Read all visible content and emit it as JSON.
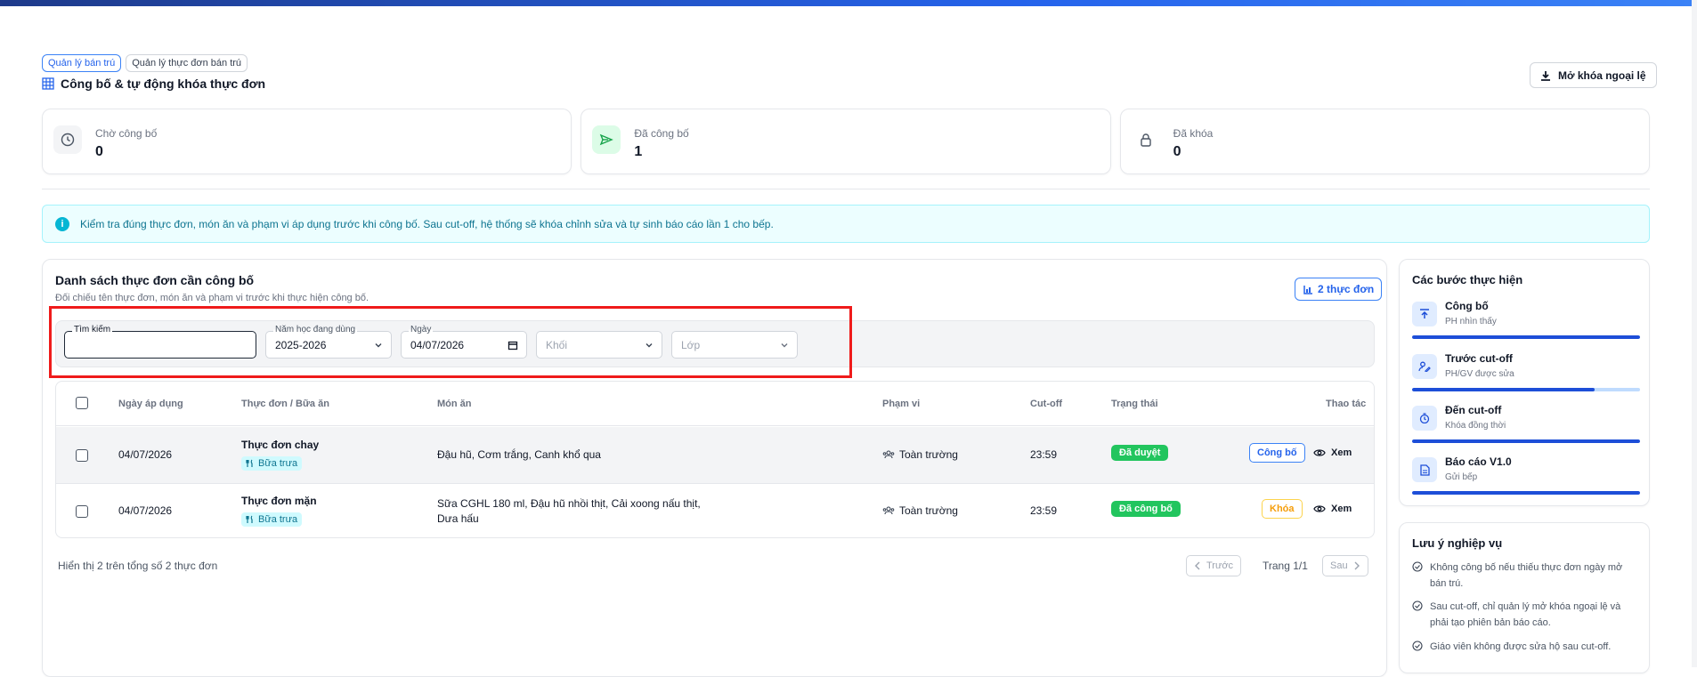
{
  "breadcrumbs": [
    "Quản lý bán trú",
    "Quản lý thực đơn bán trú"
  ],
  "page_title": "Công bố & tự động khóa thực đơn",
  "unlock_button": "Mở khóa ngoại lệ",
  "stats": [
    {
      "label": "Chờ công bố",
      "value": "0",
      "icon": "clock-icon"
    },
    {
      "label": "Đã công bố",
      "value": "1",
      "icon": "send-icon"
    },
    {
      "label": "Đã khóa",
      "value": "0",
      "icon": "lock-icon"
    }
  ],
  "alert": "Kiểm tra đúng thực đơn, món ăn và phạm vi áp dụng trước khi công bố. Sau cut-off, hệ thống sẽ khóa chỉnh sửa và tự sinh báo cáo lần 1 cho bếp.",
  "list": {
    "title": "Danh sách thực đơn cần công bố",
    "subtitle": "Đối chiếu tên thực đơn, món ăn và phạm vi trước khi thực hiện công bố.",
    "count_label": "2 thực đơn"
  },
  "filters": {
    "search_label": "Tìm kiếm",
    "search_value": "",
    "year_label": "Năm học đang dùng",
    "year_value": "2025-2026",
    "date_label": "Ngày",
    "date_value": "04/07/2026",
    "grade_placeholder": "Khối",
    "class_placeholder": "Lớp"
  },
  "table": {
    "headers": [
      "Ngày áp dụng",
      "Thực đơn / Bữa ăn",
      "Món ăn",
      "Phạm vi",
      "Cut-off",
      "Trạng thái",
      "Thao tác"
    ],
    "rows": [
      {
        "date": "04/07/2026",
        "menu": "Thực đơn chay",
        "meal": "Bữa trưa",
        "dishes": "Đậu hũ, Cơm trắng, Canh khổ qua",
        "dishes2": "",
        "scope": "Toàn trường",
        "cutoff": "23:59",
        "status": "Đã duyệt",
        "action": "Công bố",
        "view": "Xem"
      },
      {
        "date": "04/07/2026",
        "menu": "Thực đơn mặn",
        "meal": "Bữa trưa",
        "dishes": "Sữa CGHL 180 ml, Đậu hũ nhồi thịt, Cải xoong nấu thịt,",
        "dishes2": "Dưa hấu",
        "scope": "Toàn trường",
        "cutoff": "23:59",
        "status": "Đã công bố",
        "action": "Khóa",
        "view": "Xem"
      }
    ]
  },
  "footer": {
    "summary": "Hiển thị 2 trên tổng số 2 thực đơn",
    "prev": "Trước",
    "page": "Trang 1/1",
    "next": "Sau"
  },
  "steps": {
    "title": "Các bước thực hiện",
    "items": [
      {
        "name": "Công bố",
        "sub": "PH nhìn thấy",
        "icon": "upload-icon",
        "progress": 1.0
      },
      {
        "name": "Trước cut-off",
        "sub": "PH/GV được sửa",
        "icon": "user-edit-icon",
        "progress": 0.8
      },
      {
        "name": "Đến cut-off",
        "sub": "Khóa đồng thời",
        "icon": "timer-icon",
        "progress": 1.0
      },
      {
        "name": "Báo cáo V1.0",
        "sub": "Gửi bếp",
        "icon": "document-icon",
        "progress": 1.0
      }
    ]
  },
  "notes": {
    "title": "Lưu ý nghiệp vụ",
    "items": [
      {
        "l1": "Không công bố nếu thiếu thực đơn ngày mở",
        "l2": "bán trú."
      },
      {
        "l1": "Sau cut-off, chỉ quản lý mở khóa ngoại lệ và",
        "l2": "phải tạo phiên bản báo cáo."
      },
      {
        "l1": "Giáo viên không được sửa hộ sau cut-off.",
        "l2": ""
      }
    ]
  },
  "colors": {
    "accent": "#2563eb",
    "success": "#22c55e",
    "warning": "#f59e0b",
    "info": "#06b6d4"
  }
}
